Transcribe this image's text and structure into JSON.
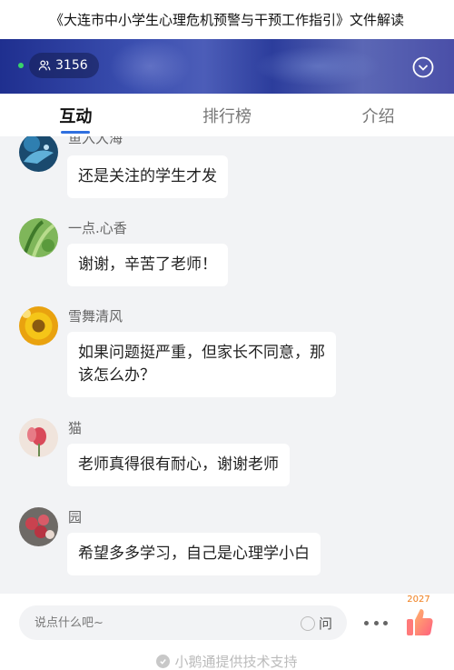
{
  "page": {
    "title": "《大连市中小学生心理危机预警与干预工作指引》文件解读"
  },
  "live": {
    "viewer_count": "3156"
  },
  "tabs": [
    {
      "label": "互动",
      "active": true
    },
    {
      "label": "排行榜",
      "active": false
    },
    {
      "label": "介绍",
      "active": false
    }
  ],
  "messages": [
    {
      "user": "鱼入大海",
      "text": "还是关注的学生才发"
    },
    {
      "user": "一点.心香",
      "text": "谢谢，辛苦了老师！"
    },
    {
      "user": "雪舞清风",
      "text_lines": [
        "如果问题挺严重，但家长不同意，那",
        "该怎么办？"
      ]
    },
    {
      "user": "猫",
      "text": "老师真得很有耐心，谢谢老师"
    },
    {
      "user": "园",
      "text": "希望多多学习，自己是心理学小白"
    }
  ],
  "composer": {
    "placeholder": "说点什么吧~",
    "ask_label": "问",
    "like_count": "2027"
  },
  "footer": {
    "text": "小鹅通提供技术支持"
  },
  "colors": {
    "accent": "#2f6fdf",
    "like": "#ef7d1a",
    "live": "#38d46a"
  }
}
